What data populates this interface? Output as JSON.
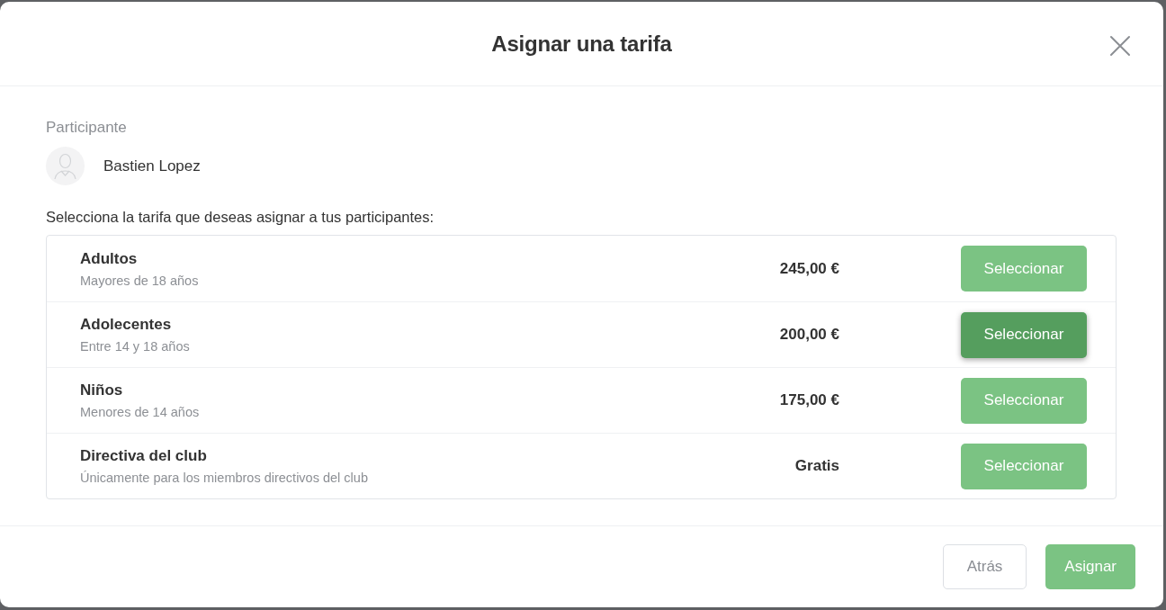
{
  "dialog": {
    "title": "Asignar una tarifa"
  },
  "participant": {
    "label": "Participante",
    "name": "Bastien Lopez"
  },
  "instruction": "Selecciona la tarifa que deseas asignar a tus participantes:",
  "tariffs": [
    {
      "name": "Adultos",
      "description": "Mayores de 18 años",
      "price": "245,00 €",
      "button": "Seleccionar",
      "hovered": false
    },
    {
      "name": "Adolecentes",
      "description": "Entre 14 y 18 años",
      "price": "200,00 €",
      "button": "Seleccionar",
      "hovered": true
    },
    {
      "name": "Niños",
      "description": "Menores de 14 años",
      "price": "175,00 €",
      "button": "Seleccionar",
      "hovered": false
    },
    {
      "name": "Directiva del club",
      "description": "Únicamente para los miembros directivos del club",
      "price": "Gratis",
      "button": "Seleccionar",
      "hovered": false
    }
  ],
  "footer_buttons": [
    {
      "label": "Atrás",
      "kind": "secondary"
    },
    {
      "label": "Asignar",
      "kind": "primary"
    }
  ]
}
